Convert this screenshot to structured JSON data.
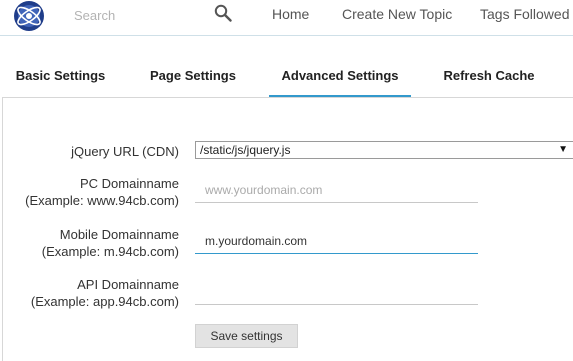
{
  "header": {
    "search": {
      "placeholder": "Search",
      "value": ""
    },
    "nav": {
      "home": "Home",
      "create_topic": "Create New Topic",
      "tags_followed": "Tags Followed"
    }
  },
  "tabs": [
    {
      "label": "Basic Settings",
      "active": false
    },
    {
      "label": "Page Settings",
      "active": false
    },
    {
      "label": "Advanced Settings",
      "active": true
    },
    {
      "label": "Refresh Cache",
      "active": false
    }
  ],
  "form": {
    "jquery": {
      "label": "jQuery URL (CDN)",
      "selected": "/static/js/jquery.js",
      "arrow": "▼"
    },
    "pc": {
      "label": "PC Domainname",
      "example": "(Example:  www.94cb.com)",
      "placeholder": "www.yourdomain.com",
      "value": ""
    },
    "mobile": {
      "label": "Mobile Domainname",
      "example": "(Example:  m.94cb.com)",
      "placeholder": "",
      "value": "m.yourdomain.com"
    },
    "api": {
      "label": "API Domainname",
      "example": "(Example:  app.94cb.com)",
      "placeholder": "",
      "value": ""
    },
    "save_label": "Save settings"
  },
  "colors": {
    "accent": "#3399cc",
    "logo_dark": "#1f3d8a"
  },
  "icons": {
    "logo": "logo-icon",
    "search": "search-icon"
  }
}
